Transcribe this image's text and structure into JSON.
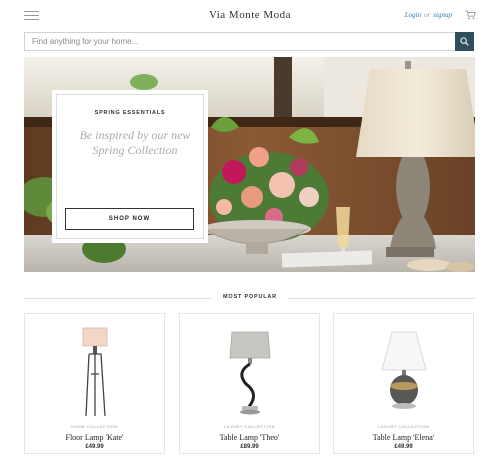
{
  "header": {
    "brand": "Via Monte Moda",
    "login_label": "Login",
    "or_label": "or",
    "signup_label": "signup"
  },
  "search": {
    "placeholder": "Find anything for your home..."
  },
  "hero": {
    "kicker": "SPRING ESSENTIALS",
    "title": "Be inspired by our new Spring Collection",
    "cta_label": "SHOP NOW"
  },
  "section": {
    "title": "MOST POPULAR"
  },
  "products": [
    {
      "collection": "HOME COLLECTION",
      "name": "Floor Lamp 'Kate'",
      "price": "£49.99"
    },
    {
      "collection": "LUXURY COLLECTION",
      "name": "Table Lamp 'Theo'",
      "price": "£89.99"
    },
    {
      "collection": "LUXURY COLLECTION",
      "name": "Table Lamp 'Elena'",
      "price": "£49.99"
    }
  ],
  "colors": {
    "accent_link": "#2b7fb5",
    "search_button": "#2f4f5e"
  },
  "icons": [
    "menu-icon",
    "cart-icon",
    "search-icon"
  ]
}
